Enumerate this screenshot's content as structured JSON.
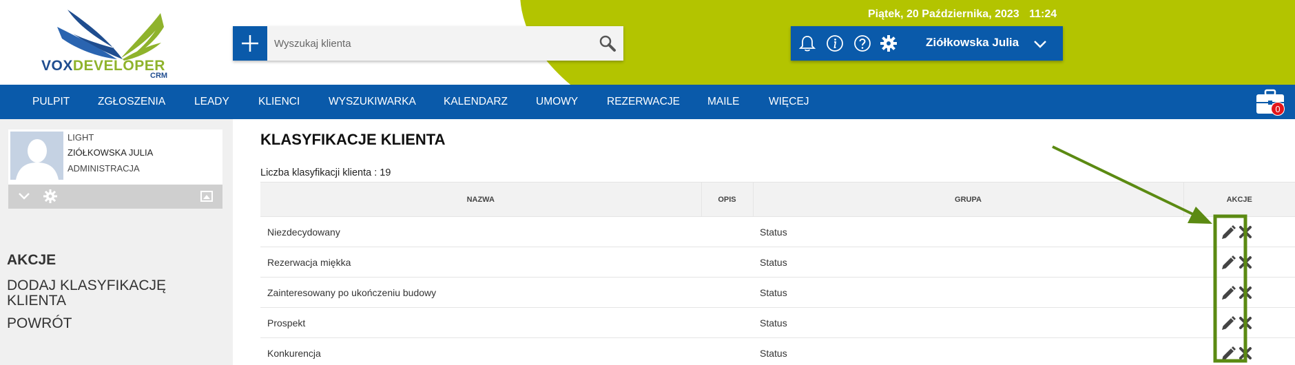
{
  "header": {
    "logo_text_a": "VOX",
    "logo_text_b": "DEVELOPER",
    "logo_sub": "CRM",
    "search_placeholder": "Wyszukaj klienta",
    "date": "Piątek, 20 Października, 2023",
    "time": "11:24",
    "user_name": "Ziółkowska Julia"
  },
  "nav": {
    "items": [
      "PULPIT",
      "ZGŁOSZENIA",
      "LEADY",
      "KLIENCI",
      "WYSZUKIWARKA",
      "KALENDARZ",
      "UMOWY",
      "REZERWACJE",
      "MAILE",
      "WIĘCEJ"
    ],
    "badge_count": "0"
  },
  "sidebar": {
    "profile": {
      "plan": "LIGHT",
      "name": "ZIÓŁKOWSKA JULIA",
      "department": "ADMINISTRACJA"
    },
    "actions_heading": "AKCJE",
    "links": [
      "DODAJ KLASYFIKACJĘ KLIENTA",
      "POWRÓT"
    ]
  },
  "main": {
    "title": "KLASYFIKACJE KLIENTA",
    "count_label": "Liczba klasyfikacji klienta : 19",
    "columns": [
      "NAZWA",
      "OPIS",
      "GRUPA",
      "AKCJE"
    ],
    "rows": [
      {
        "nazwa": "Niezdecydowany",
        "opis": "",
        "grupa": "Status"
      },
      {
        "nazwa": "Rezerwacja miękka",
        "opis": "",
        "grupa": "Status"
      },
      {
        "nazwa": "Zainteresowany po ukończeniu budowy",
        "opis": "",
        "grupa": "Status"
      },
      {
        "nazwa": "Prospekt",
        "opis": "",
        "grupa": "Status"
      },
      {
        "nazwa": "Konkurencja",
        "opis": "",
        "grupa": "Status"
      }
    ]
  },
  "colors": {
    "brand_blue": "#0a5aaa",
    "accent_green": "#b3c400",
    "annotation_green": "#5b8a12",
    "badge_red": "#e3151a"
  },
  "icons": {
    "toolbar": [
      "plus-icon",
      "search-icon"
    ],
    "user_bar": [
      "bell-icon",
      "info-icon",
      "help-icon",
      "gear-icon",
      "chevron-down-icon"
    ],
    "row_actions": [
      "pencil-icon",
      "close-icon"
    ]
  }
}
